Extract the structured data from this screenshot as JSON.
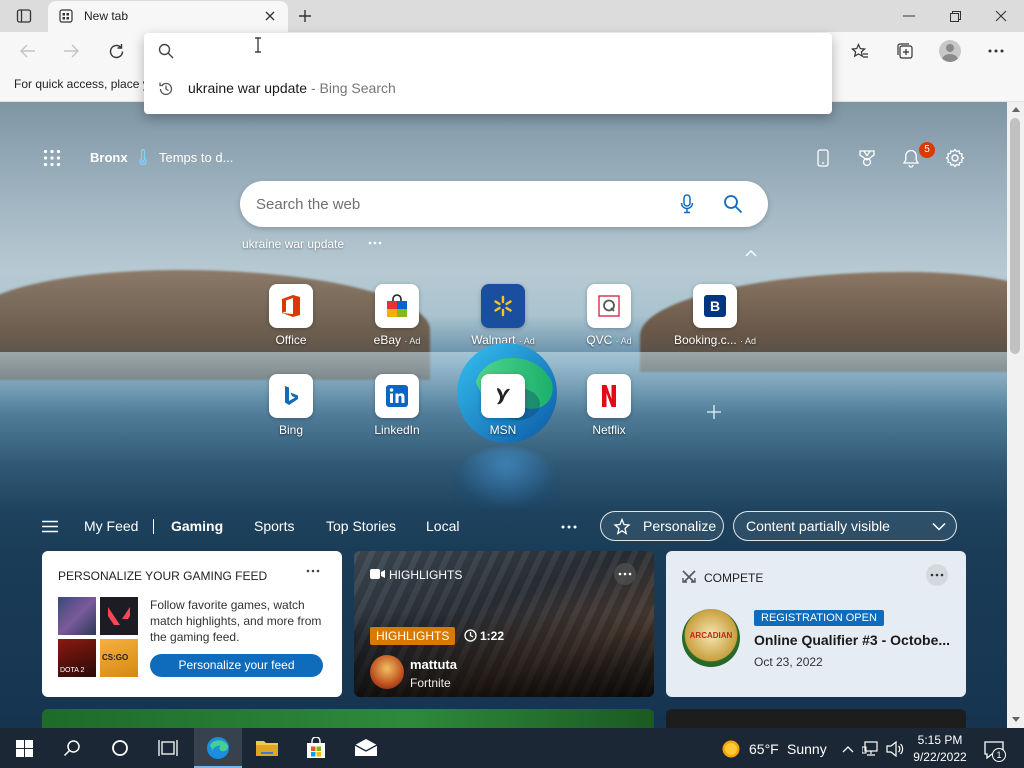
{
  "browser": {
    "tab_title": "New tab",
    "favbar_text": "For quick access, place y",
    "address_value": ""
  },
  "suggestion": {
    "query": "ukraine war update",
    "source": "- Bing Search"
  },
  "ntp": {
    "location": "Bronx",
    "weather_text": "Temps to d...",
    "notification_count": "5",
    "search_placeholder": "Search the web",
    "recent_search": "ukraine war update",
    "quick_links": [
      {
        "label": "Office",
        "ad": ""
      },
      {
        "label": "eBay",
        "ad": "· Ad"
      },
      {
        "label": "Walmart",
        "ad": "· Ad"
      },
      {
        "label": "QVC",
        "ad": "· Ad"
      },
      {
        "label": "Booking.c...",
        "ad": "· Ad"
      },
      {
        "label": "Bing",
        "ad": ""
      },
      {
        "label": "LinkedIn",
        "ad": ""
      },
      {
        "label": "MSN",
        "ad": ""
      },
      {
        "label": "Netflix",
        "ad": ""
      }
    ]
  },
  "feed_nav": {
    "items": [
      "My Feed",
      "Gaming",
      "Sports",
      "Top Stories",
      "Local"
    ],
    "active": "Gaming",
    "personalize": "Personalize",
    "visibility": "Content partially visible"
  },
  "cards": {
    "personalize": {
      "title": "PERSONALIZE YOUR GAMING FEED",
      "body": "Follow favorite games, watch match highlights, and more from the gaming feed.",
      "button": "Personalize your feed",
      "game_labels": [
        "DOTA 2",
        "CS:GO"
      ]
    },
    "highlights": {
      "header": "HIGHLIGHTS",
      "badge": "HIGHLIGHTS",
      "duration": "1:22",
      "streamer": "mattuta",
      "game": "Fortnite"
    },
    "compete": {
      "header": "COMPETE",
      "badge": "REGISTRATION OPEN",
      "title": "Online Qualifier #3 - Octobe...",
      "date": "Oct 23, 2022",
      "logo_text": "ARCADIAN"
    }
  },
  "taskbar": {
    "weather_temp": "65°F",
    "weather_cond": "Sunny",
    "time": "5:15 PM",
    "date": "9/22/2022",
    "notif_count": "1"
  },
  "colors": {
    "accent": "#0f6cbd",
    "highlight_badge": "#d97a00",
    "registration_badge": "#0f6cbd",
    "taskbar": "#1b2734"
  }
}
